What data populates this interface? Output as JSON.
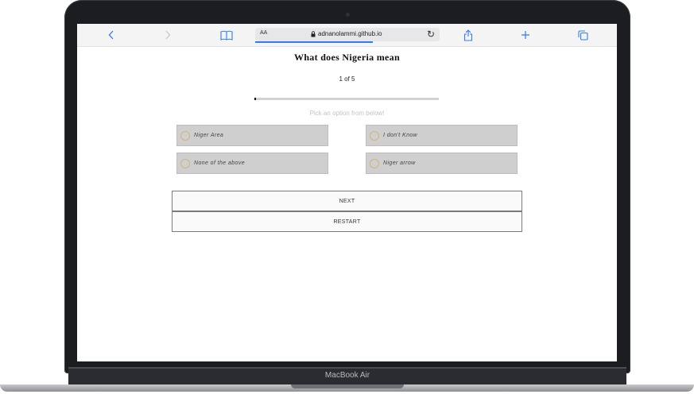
{
  "browser": {
    "text_size_label": "AA",
    "url": "adnanolammi.github.io",
    "reload_icon": "reload-icon",
    "back_icon": "chevron-left-icon",
    "forward_icon": "chevron-right-icon",
    "bookmarks_icon": "book-icon",
    "share_icon": "share-icon",
    "new_tab_icon": "plus-icon",
    "tabs_icon": "tabs-icon",
    "accent_color": "#2f7cf6"
  },
  "quiz": {
    "question": "What does Nigeria mean",
    "counter": "1 of 5",
    "progress_fraction": 0.01,
    "hint": "Pick an option from below!",
    "options": [
      {
        "label": "Niger Area"
      },
      {
        "label": "I don't Know"
      },
      {
        "label": "None of the above"
      },
      {
        "label": "Niger arrow"
      }
    ],
    "next_label": "NEXT",
    "restart_label": "RESTART"
  },
  "device": {
    "model_label": "MacBook Air"
  }
}
